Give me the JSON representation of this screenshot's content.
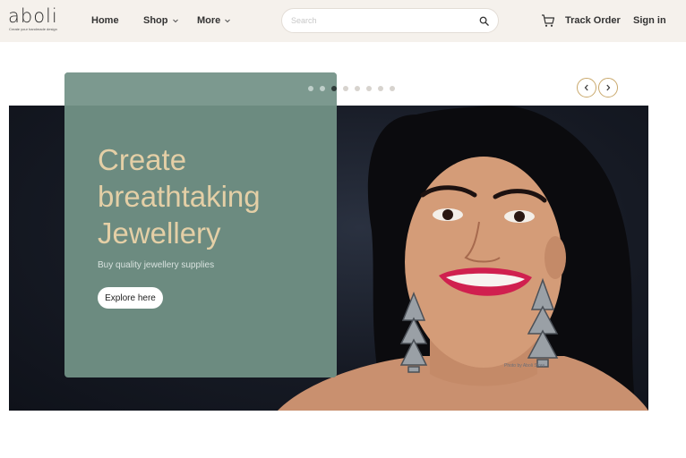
{
  "brand": {
    "name": "aboli",
    "tagline": "Create your handmade design"
  },
  "nav": {
    "home": "Home",
    "shop": "Shop",
    "more": "More"
  },
  "search": {
    "placeholder": "Search",
    "icon": "search-icon"
  },
  "header_actions": {
    "track_order": "Track Order",
    "sign_in": "Sign in",
    "cart_icon": "cart-icon"
  },
  "carousel": {
    "slide_count": 8,
    "active_index": 2,
    "prev_icon": "chevron-left-icon",
    "next_icon": "chevron-right-icon"
  },
  "hero": {
    "title": "Create breathtaking Jewellery",
    "subtitle": "Buy quality jewellery supplies",
    "cta": "Explore here",
    "photo_credit": "Photo by Aboli Store"
  },
  "colors": {
    "header_bg": "#f5f1ec",
    "card_bg": "#6c8b80",
    "title_gold": "#e4cfa6",
    "accent_ring": "#c9a86b"
  }
}
